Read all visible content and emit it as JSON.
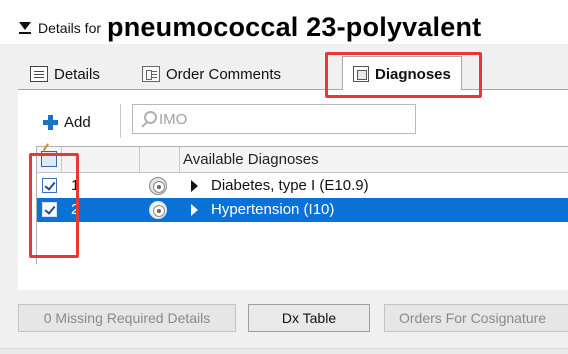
{
  "title": {
    "prefix": "Details for",
    "main": "pneumococcal 23-polyvalent"
  },
  "tabs": [
    {
      "label": "Details",
      "icon": "details-doc-icon"
    },
    {
      "label": "Order Comments",
      "icon": "comments-icon"
    },
    {
      "label": "Diagnoses",
      "icon": "diagnoses-icon",
      "active": true
    }
  ],
  "toolbar": {
    "add_label": "Add",
    "search_placeholder": "IMO"
  },
  "grid": {
    "header": "Available Diagnoses",
    "rows": [
      {
        "checked": true,
        "number": "1",
        "diagnosis": "Diabetes, type I (E10.9)",
        "selected": false
      },
      {
        "checked": true,
        "number": "2",
        "diagnosis": "Hypertension (I10)",
        "selected": true
      }
    ]
  },
  "footer": {
    "missing_label": "0 Missing Required Details",
    "dx_table_label": "Dx Table",
    "cosign_label": "Orders For Cosignature"
  },
  "colors": {
    "highlight": "#e53935",
    "selection": "#0a72d6",
    "add_plus": "#1a73c9"
  }
}
